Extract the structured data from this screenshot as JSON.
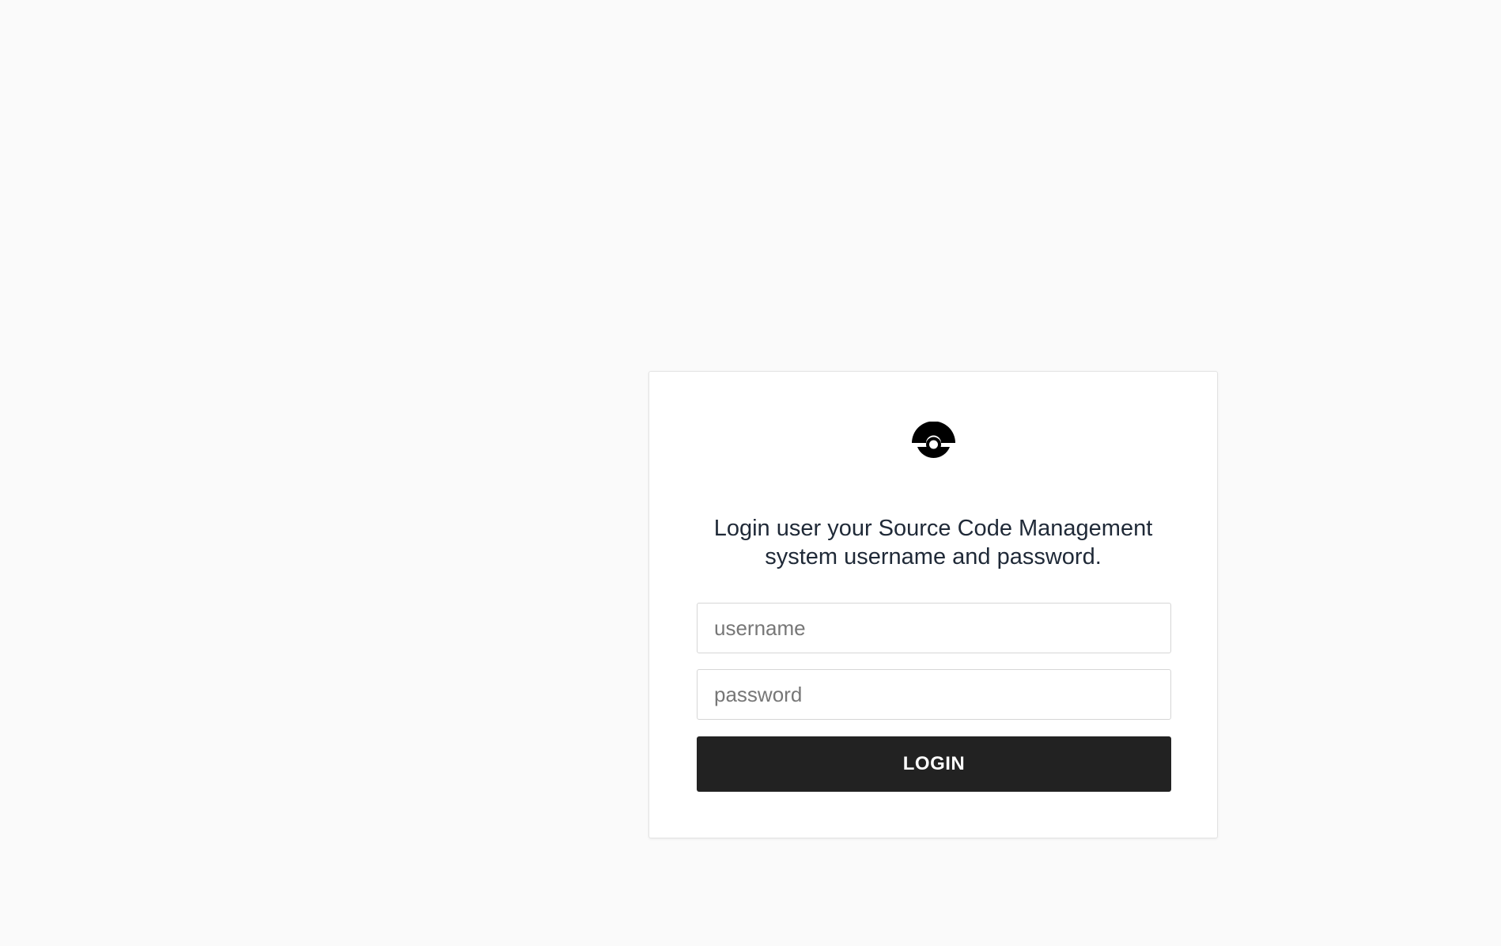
{
  "login": {
    "logo_icon": "drone-logo-icon",
    "message": "Login user your Source Code Management system username and password.",
    "username": {
      "placeholder": "username",
      "value": ""
    },
    "password": {
      "placeholder": "password",
      "value": ""
    },
    "button_label": "LOGIN"
  },
  "colors": {
    "background": "#fafafa",
    "card": "#ffffff",
    "button": "#222222",
    "button_text": "#ffffff",
    "text": "#1f2937"
  }
}
